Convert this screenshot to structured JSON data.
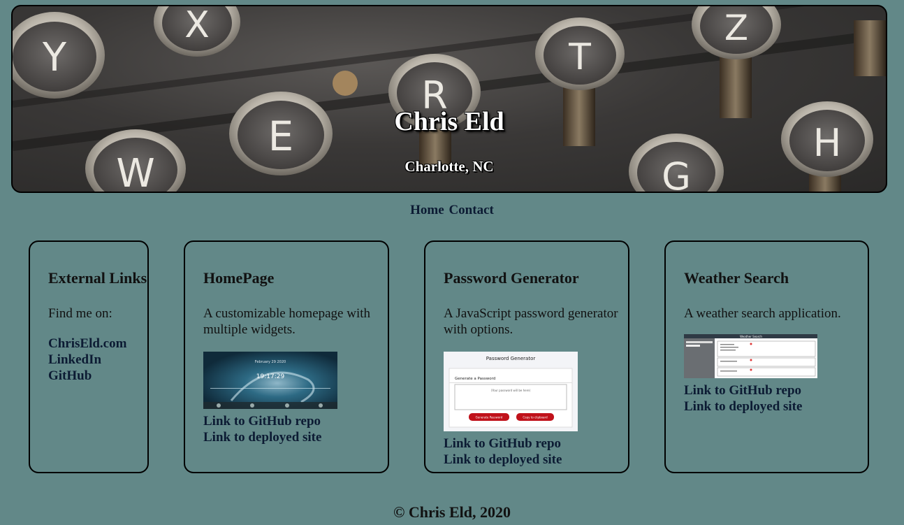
{
  "header": {
    "name": "Chris Eld",
    "location": "Charlotte, NC",
    "keys": [
      "Y",
      "X",
      "E",
      "R",
      "T",
      "Z",
      "W",
      "G",
      "H"
    ]
  },
  "nav": {
    "home": "Home",
    "contact": "Contact"
  },
  "external": {
    "title": "External Links",
    "subtitle": "Find me on:",
    "links": [
      "ChrisEld.com",
      "LinkedIn",
      "GitHub"
    ]
  },
  "projects": [
    {
      "title": "HomePage",
      "description": "A customizable homepage with multiple widgets.",
      "thumb": {
        "date": "February 29 2020",
        "time": "19:17:29"
      },
      "repo": "Link to GitHub repo",
      "site": "Link to deployed site"
    },
    {
      "title": "Password Generator",
      "description": "A JavaScript password generator with options.",
      "thumb": {
        "title": "Password Generator",
        "heading": "Generate a Password",
        "sample": "(Your password will be here)",
        "btn1": "Generate Password",
        "btn2": "Copy to clipboard"
      },
      "repo": "Link to GitHub repo",
      "site": "Link to deployed site"
    },
    {
      "title": "Weather Search",
      "description": "A weather search application.",
      "thumb": {
        "title": "Weather Search"
      },
      "repo": "Link to GitHub repo",
      "site": "Link to deployed site"
    }
  ],
  "footer": "© Chris Eld, 2020",
  "colors": {
    "background": "#628888",
    "link": "#0c1b33",
    "accent": "#c0111a"
  }
}
